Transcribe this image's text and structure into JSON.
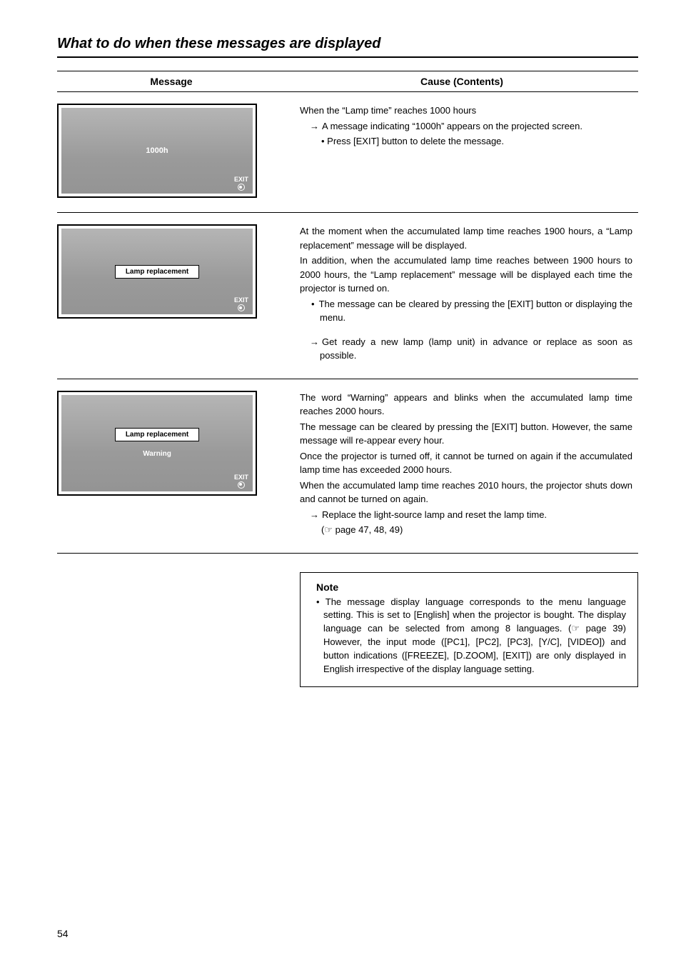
{
  "section_title": "What to do when these messages are displayed",
  "headers": {
    "message": "Message",
    "cause": "Cause (Contents)"
  },
  "rows": {
    "r1": {
      "screen_text": "1000h",
      "exit_label": "EXIT",
      "cause_line1": "When the “Lamp time” reaches 1000 hours",
      "cause_line2": "A message indicating “1000h” appears on the projected screen.",
      "cause_line3": "• Press [EXIT] button to delete the message."
    },
    "r2": {
      "screen_label": "Lamp replacement",
      "exit_label": "EXIT",
      "p1": "At the moment when the accumulated lamp time reaches 1900 hours, a “Lamp replacement” message will be displayed.",
      "p2": "In addition, when the accumulated lamp time reaches between 1900 hours to 2000 hours, the “Lamp replacement” message will be displayed each time the projector is turned on.",
      "bullet": "The message can be cleared by pressing the [EXIT] button or displaying the menu.",
      "p3": "Get ready a new lamp (lamp unit) in advance or replace as soon as possible."
    },
    "r3": {
      "screen_label": "Lamp replacement",
      "warning": "Warning",
      "exit_label": "EXIT",
      "p1": "The word “Warning” appears and blinks when the accumulated lamp time reaches 2000 hours.",
      "p2": "The message can be cleared by pressing the [EXIT] button. However, the same message will re-appear every hour.",
      "p3": "Once the projector is turned off, it cannot be turned on again if the accumulated lamp time has exceeded 2000 hours.",
      "p4": "When the accumulated lamp time reaches 2010 hours, the projector shuts down and cannot be turned on again.",
      "p5": "Replace the light-source lamp and reset the lamp time.",
      "ref": "(☞ page 47, 48, 49)"
    }
  },
  "note": {
    "title": "Note",
    "body": "The message display language corresponds to the menu language setting. This is set to [English] when the projector is bought. The display language can be selected from among 8 languages. (☞ page 39) However, the input mode ([PC1], [PC2], [PC3], [Y/C], [VIDEO]) and button indications ([FREEZE], [D.ZOOM], [EXIT]) are only displayed in English irrespective of the display language setting."
  },
  "page_number": "54"
}
